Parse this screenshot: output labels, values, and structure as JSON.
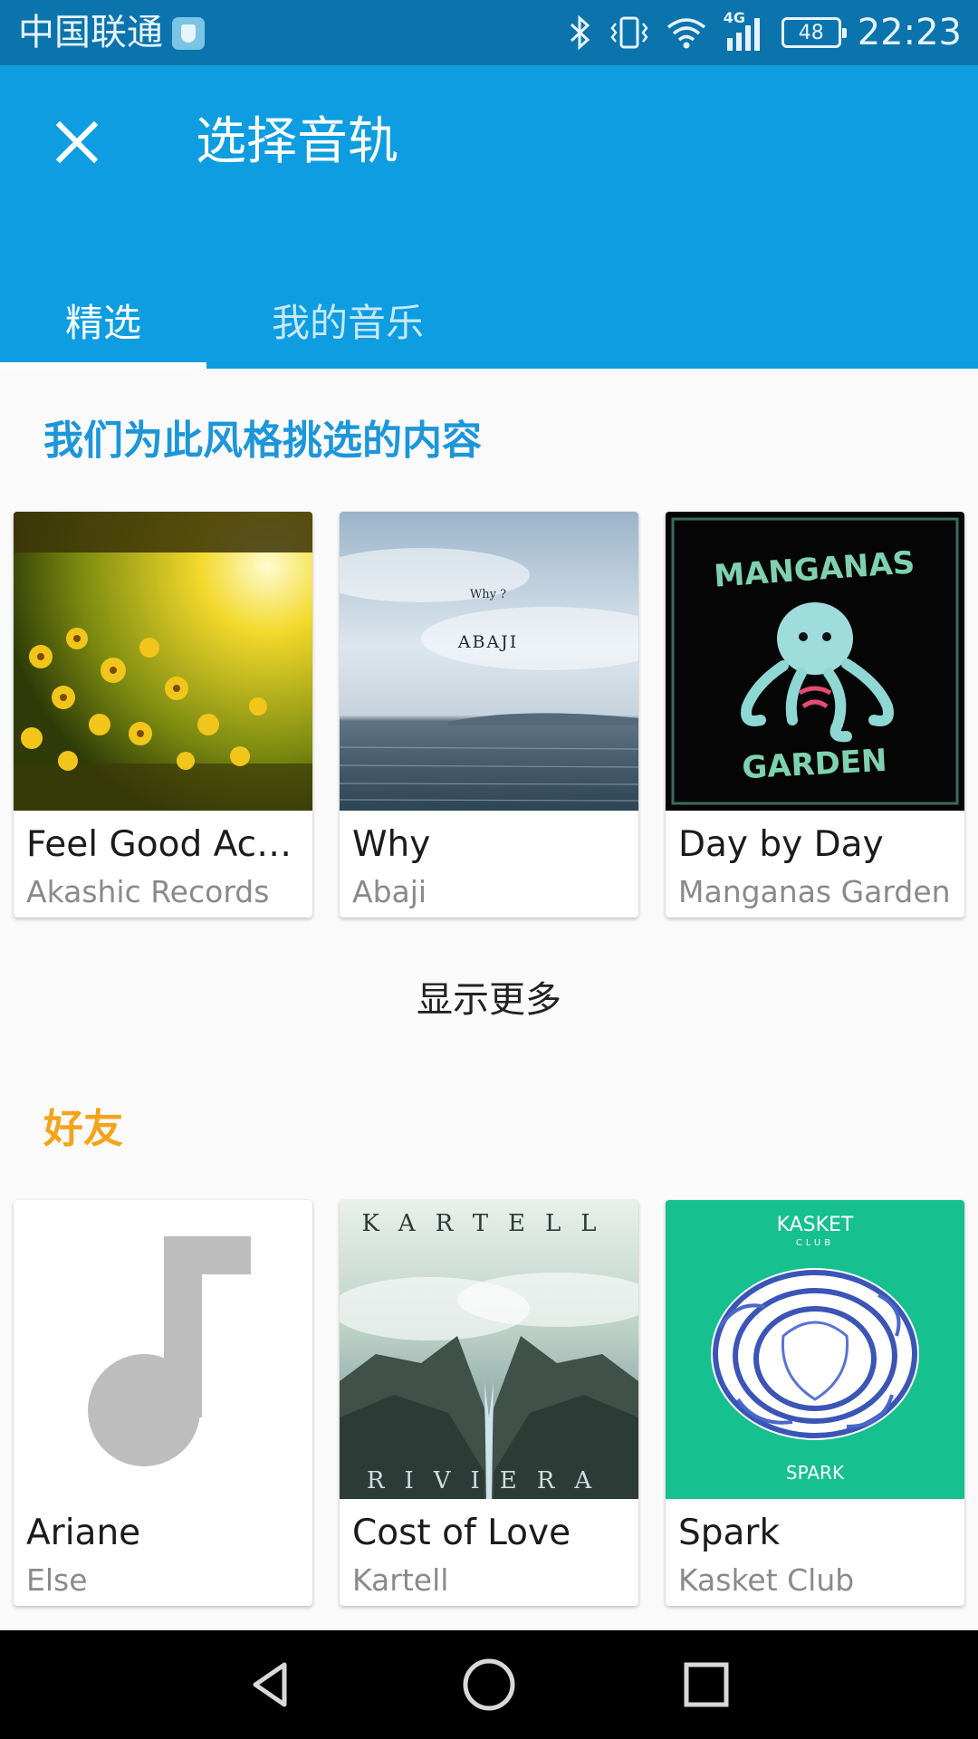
{
  "status_bar": {
    "carrier": "中国联通",
    "network": "4G",
    "battery": "48",
    "time": "22:23",
    "icons": [
      "vpn-shield-icon",
      "bluetooth-icon",
      "vibrate-icon",
      "wifi-icon",
      "signal-icon",
      "battery-icon"
    ]
  },
  "app_bar": {
    "title": "选择音轨",
    "close_icon": "close-icon",
    "background": "#0d9de0"
  },
  "tabs": [
    {
      "label": "精选",
      "selected": true
    },
    {
      "label": "我的音乐",
      "selected": false
    }
  ],
  "featured": {
    "heading": "我们为此风格挑选的内容",
    "heading_color": "#1d96d9",
    "cards": [
      {
        "title": "Feel Good Acou...",
        "artist": "Akashic Records"
      },
      {
        "title": "Why",
        "artist": "Abaji",
        "cover_text": [
          "Why ?",
          "ABAJI"
        ]
      },
      {
        "title": "Day by Day",
        "artist": "Manganas Garden",
        "cover_text": [
          "MANGANAS",
          "GARDEN"
        ]
      }
    ],
    "show_more": "显示更多"
  },
  "friends": {
    "heading": "好友",
    "heading_color": "#f4a31b",
    "cards": [
      {
        "title": "Ariane",
        "artist": "Else",
        "cover_icon": "music-note-icon"
      },
      {
        "title": "Cost of Love",
        "artist": "Kartell",
        "cover_text": [
          "KARTELL",
          "RIVIERA"
        ]
      },
      {
        "title": "Spark",
        "artist": "Kasket Club",
        "cover_text": [
          "KASKET",
          "CLUB",
          "SPARK"
        ]
      }
    ]
  },
  "nav_bar": {
    "icons": [
      "back-triangle-icon",
      "home-circle-icon",
      "recents-square-icon"
    ]
  }
}
